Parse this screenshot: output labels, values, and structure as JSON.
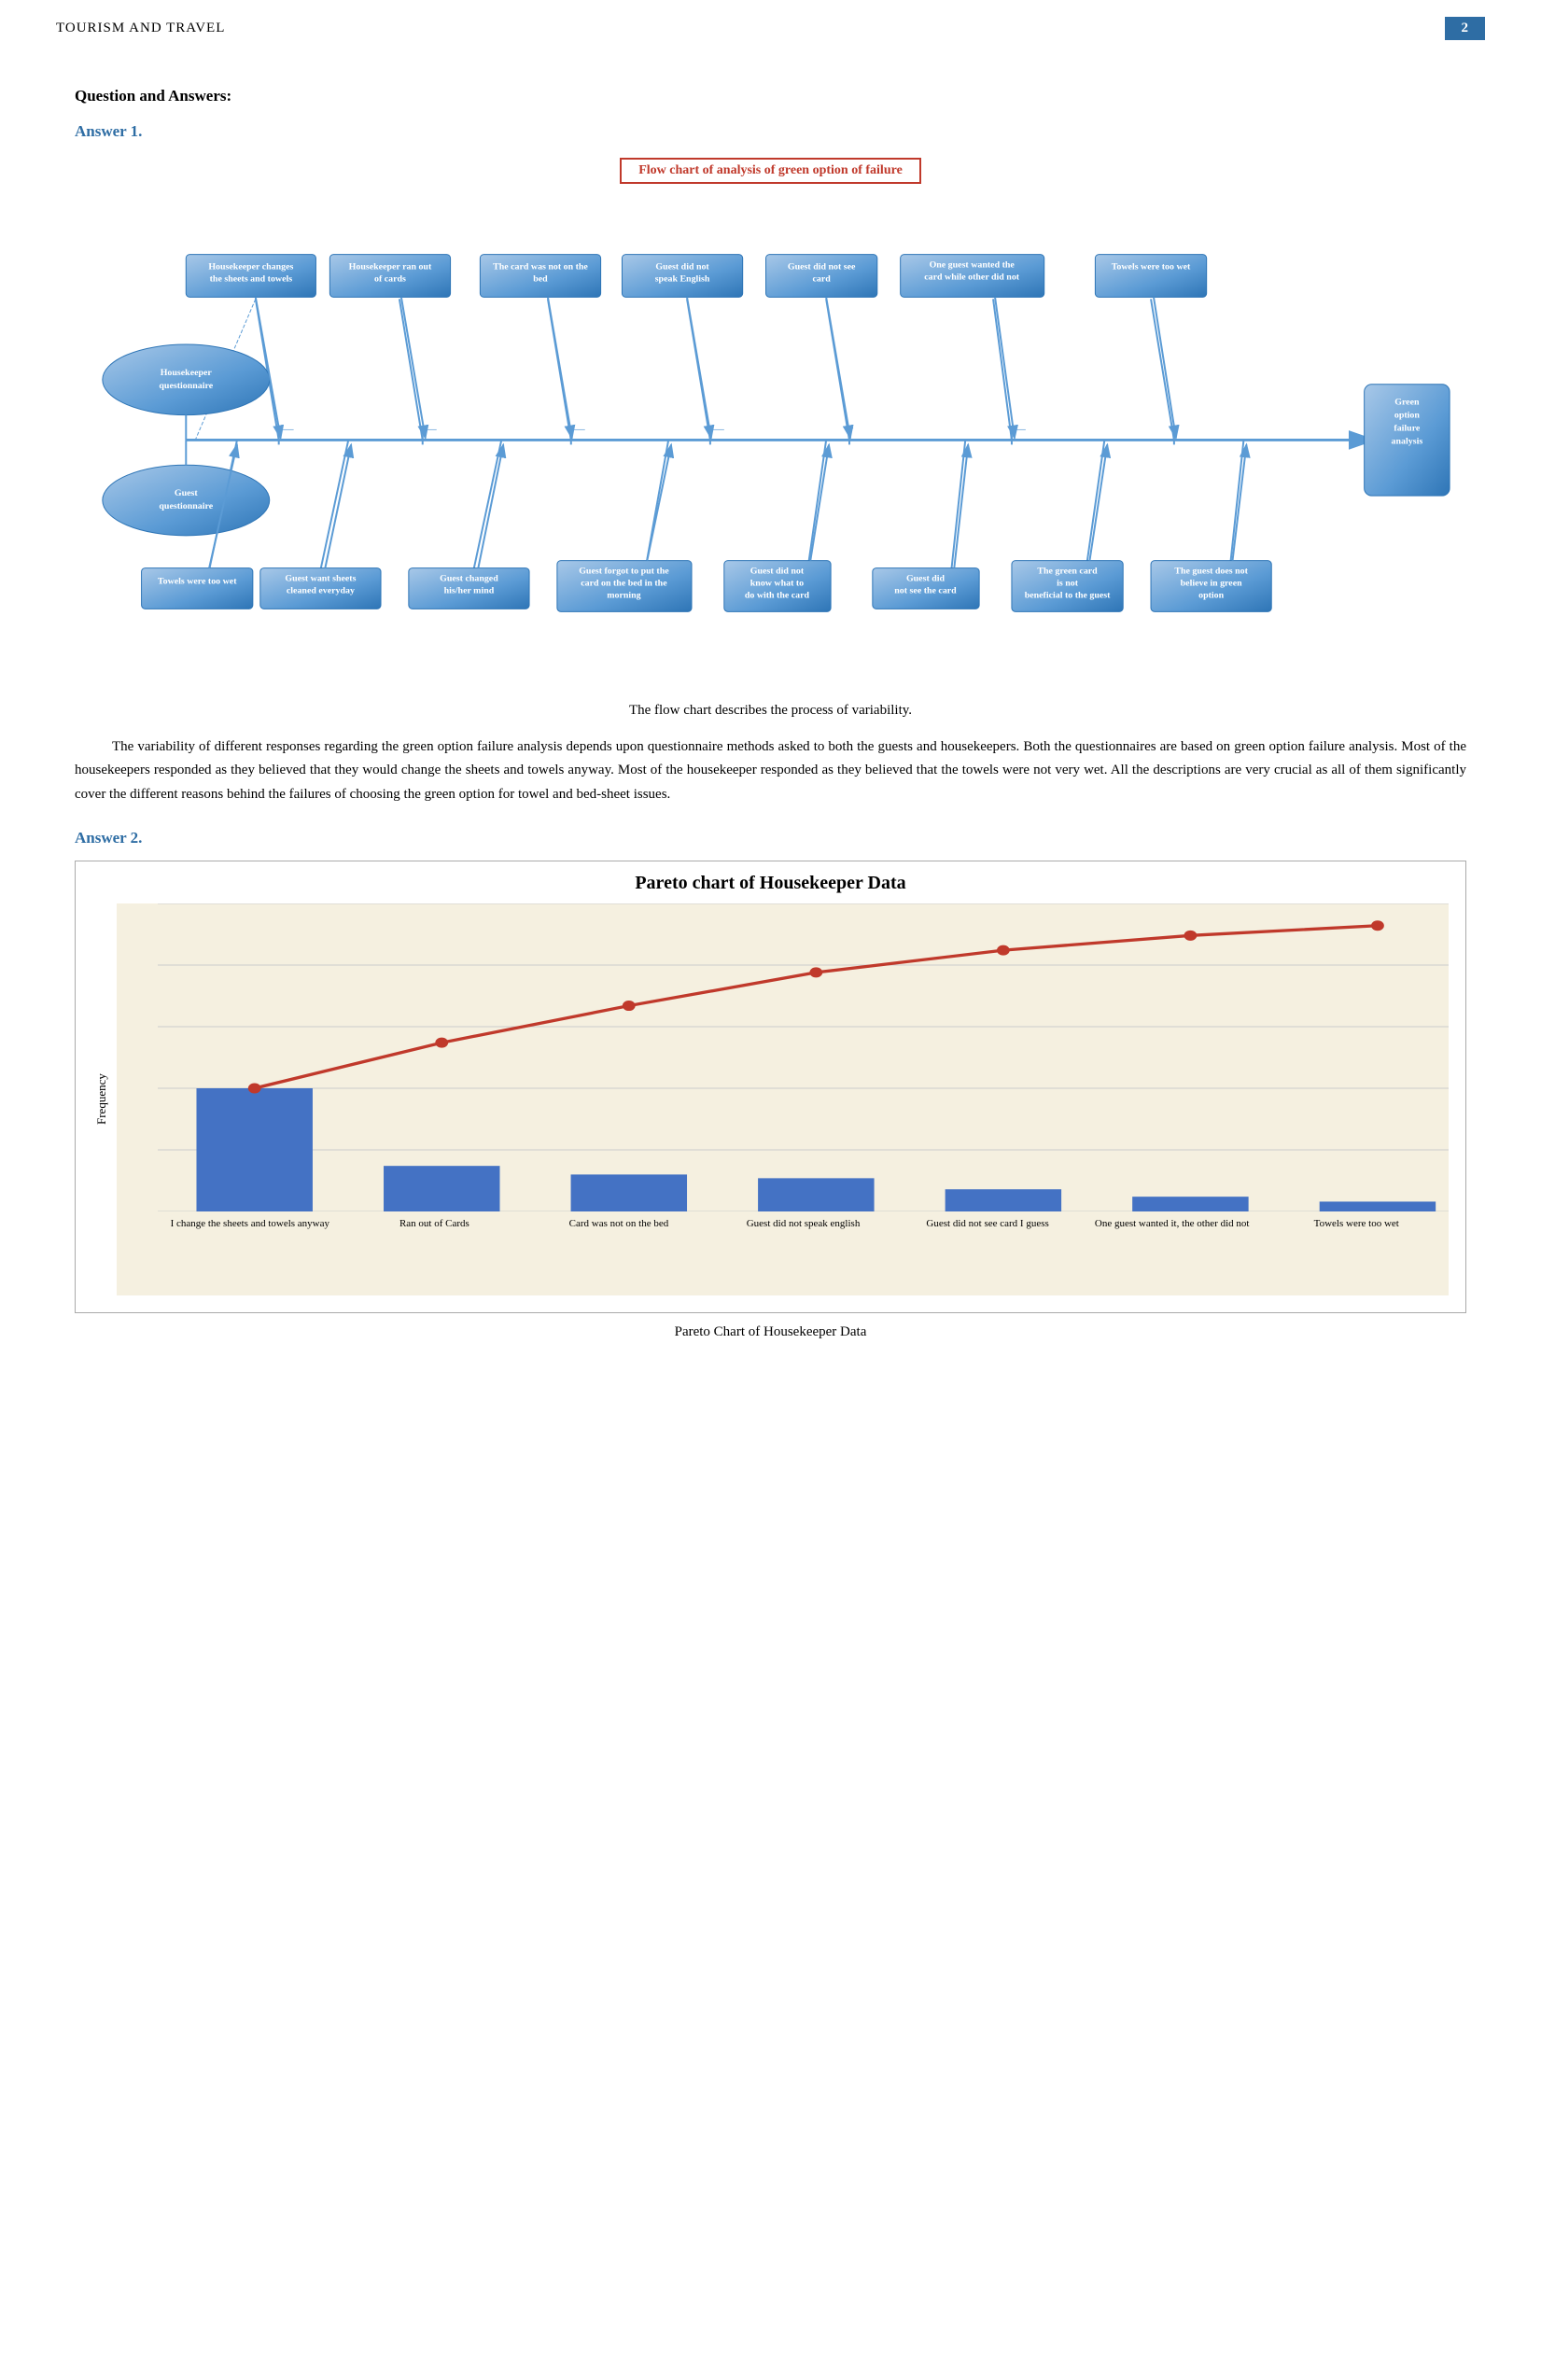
{
  "header": {
    "title": "TOURISM AND TRAVEL",
    "page_number": "2"
  },
  "section": {
    "qa_label": "Question and Answers:",
    "answer1_label": "Answer 1.",
    "answer2_label": "Answer 2."
  },
  "flowchart": {
    "title": "Flow chart of analysis of green option of failure",
    "caption": "The flow chart describes the process of variability.",
    "top_boxes": [
      "Housekeeper changes the sheets and towels",
      "Housekeeper ran out of cards",
      "The card was not on the bed",
      "Guest did not speak English",
      "Guest did not see card",
      "One guest wanted the card while other did not",
      "Towels were too wet"
    ],
    "bottom_boxes": [
      "Towels were too wet",
      "Guest want sheets cleaned everyday",
      "Guest changed his/her mind",
      "Guest forgot to put the card on the bed in the morning",
      "Guest did not know what to do with the card",
      "Guest did not see the card",
      "The green card is not beneficial to the guest",
      "The guest does not believe in green option"
    ],
    "left_ellipses": [
      "Housekeeper questionnaire",
      "Guest questionnaire"
    ],
    "right_box": "Green option failure analysis"
  },
  "body_text": {
    "para1": "The variability of different responses regarding the green option failure analysis depends upon questionnaire methods asked to both the guests and housekeepers. Both the questionnaires are based on green option failure analysis. Most of the housekeepers responded as they believed that they would change the sheets and towels anyway. Most of the housekeeper responded as they believed that the towels were not very wet. All the descriptions are very crucial as all of them significantly cover the different reasons behind the failures of choosing the green option for towel and bed-sheet issues."
  },
  "pareto_chart": {
    "title": "Pareto chart of Housekeeper Data",
    "y_axis_label": "Frequency",
    "y_ticks": [
      0,
      50,
      100,
      150,
      200,
      250
    ],
    "bars": [
      {
        "label": "I change the sheets and towels anyway",
        "value": 100
      },
      {
        "label": "Ran out of Cards",
        "value": 37
      },
      {
        "label": "Card was not on the bed",
        "value": 30
      },
      {
        "label": "Guest did not speak english",
        "value": 27
      },
      {
        "label": "Guest did not see card I guess",
        "value": 18
      },
      {
        "label": "One guest wanted it, the other did not",
        "value": 12
      },
      {
        "label": "Towels were too wet",
        "value": 8
      }
    ],
    "cumulative": [
      100,
      137,
      167,
      194,
      212,
      224,
      232
    ],
    "max_value": 250,
    "caption": "Pareto Chart of Housekeeper Data"
  }
}
